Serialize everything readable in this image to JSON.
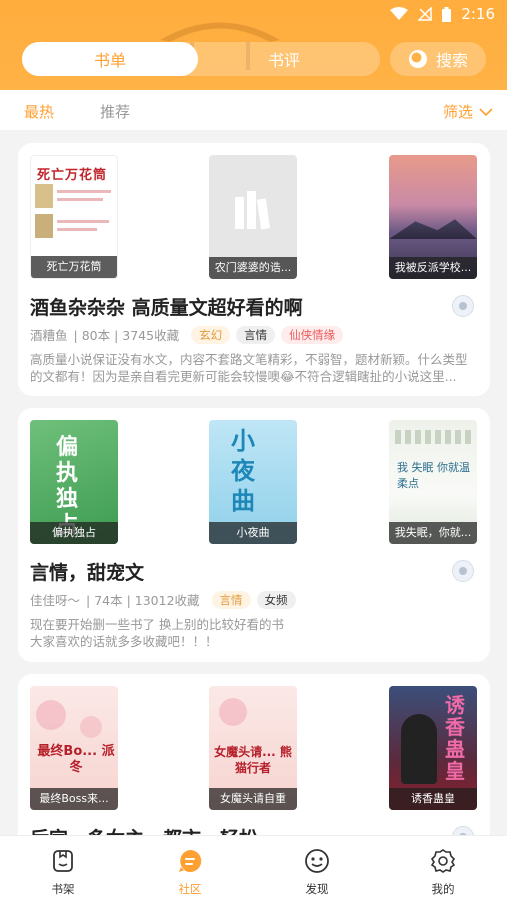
{
  "status_bar": {
    "time": "2:16"
  },
  "header": {
    "tabs": [
      {
        "label": "书单"
      },
      {
        "label": "书评"
      }
    ],
    "search_label": "搜索"
  },
  "filter_bar": {
    "sort_options": [
      "最热",
      "推荐"
    ],
    "filter_label": "筛选"
  },
  "booklists": [
    {
      "title": "酒鱼杂杂杂 高质量文超好看的啊",
      "author": "酒糟鱼",
      "stats": "| 80本 | 3745收藏",
      "tags": [
        "玄幻",
        "言情",
        "仙侠情缘"
      ],
      "description": "高质量小说保证没有水文，内容不套路文笔精彩，不弱智，题材新颖。什么类型的文都有！因为是亲自看完更新可能会较慢噢😂不符合逻辑瞎扯的小说这里...",
      "covers": [
        {
          "caption": "死亡万花筒",
          "cover_text": "死亡万花筒"
        },
        {
          "caption": "农门婆婆的诰..."
        },
        {
          "caption": "我被反派学校..."
        }
      ]
    },
    {
      "title": "言情，甜宠文",
      "author": "佳佳呀～",
      "stats": "| 74本 | 13012收藏",
      "tags": [
        "言情",
        "女频"
      ],
      "description": "现在要开始删一些书了 换上别的比较好看的书\n大家喜欢的话就多多收藏吧！！！",
      "covers": [
        {
          "caption": "偏执独占",
          "cover_text": "偏执独占"
        },
        {
          "caption": "小夜曲",
          "cover_text": "小夜曲"
        },
        {
          "caption": "我失眠，你就...",
          "cover_text": "我 失眠 你就温柔点"
        }
      ]
    },
    {
      "title": "后宫，多女主，都市，轻松",
      "covers": [
        {
          "caption": "最终Boss来...",
          "cover_text": "最终Bo... 派冬"
        },
        {
          "caption": "女魔头请自重",
          "cover_text": "女魔头请... 熊猫行者"
        },
        {
          "caption": "诱香蛊皇",
          "cover_text": "诱香蛊皇"
        }
      ]
    }
  ],
  "bottom_nav": [
    {
      "label": "书架",
      "icon": "bookshelf-icon"
    },
    {
      "label": "社区",
      "icon": "community-icon"
    },
    {
      "label": "发现",
      "icon": "discover-icon"
    },
    {
      "label": "我的",
      "icon": "settings-icon"
    }
  ],
  "colors": {
    "accent": "#ffa033",
    "header": "#ffad3d"
  }
}
